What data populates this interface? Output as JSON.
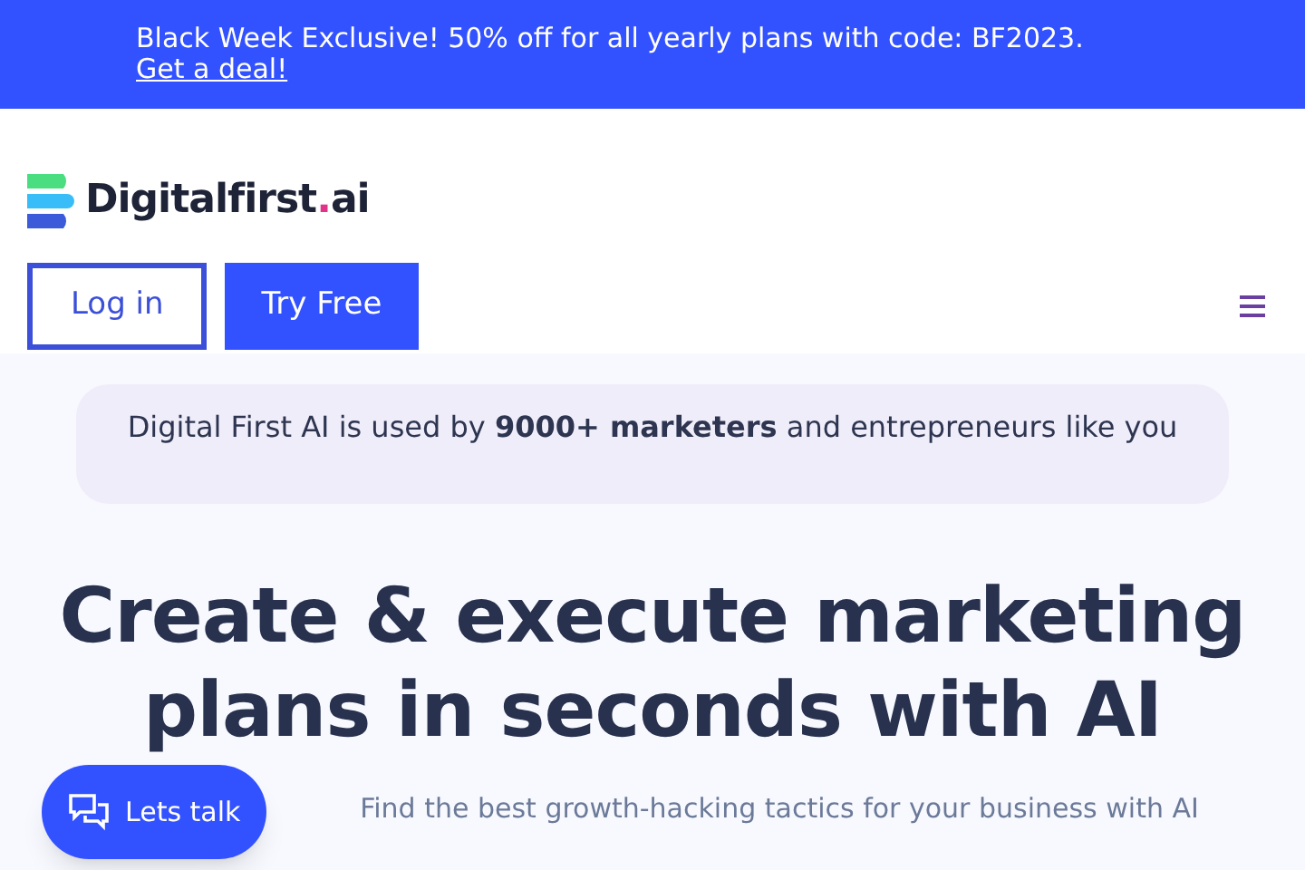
{
  "promo_banner": {
    "text": "Black Week Exclusive! 50% off for all yearly plans with code: BF2023.",
    "link": "Get a deal!"
  },
  "header": {
    "logo": {
      "name": "Digitalfirst",
      "dot": ".",
      "suffix": "ai"
    },
    "buttons": [
      {
        "kind": "outline",
        "label": "Log in"
      },
      {
        "kind": "solid",
        "label": "Try Free"
      }
    ]
  },
  "social_proof": "Digital First AI is used by **9000+ marketers** and entrepreneurs like you",
  "hero": {
    "title": "Create & execute marketing plans in seconds with AI",
    "subtitle": "Find the best growth-hacking tactics for your business with AI"
  },
  "chat_button": {
    "label": "Lets talk"
  }
}
